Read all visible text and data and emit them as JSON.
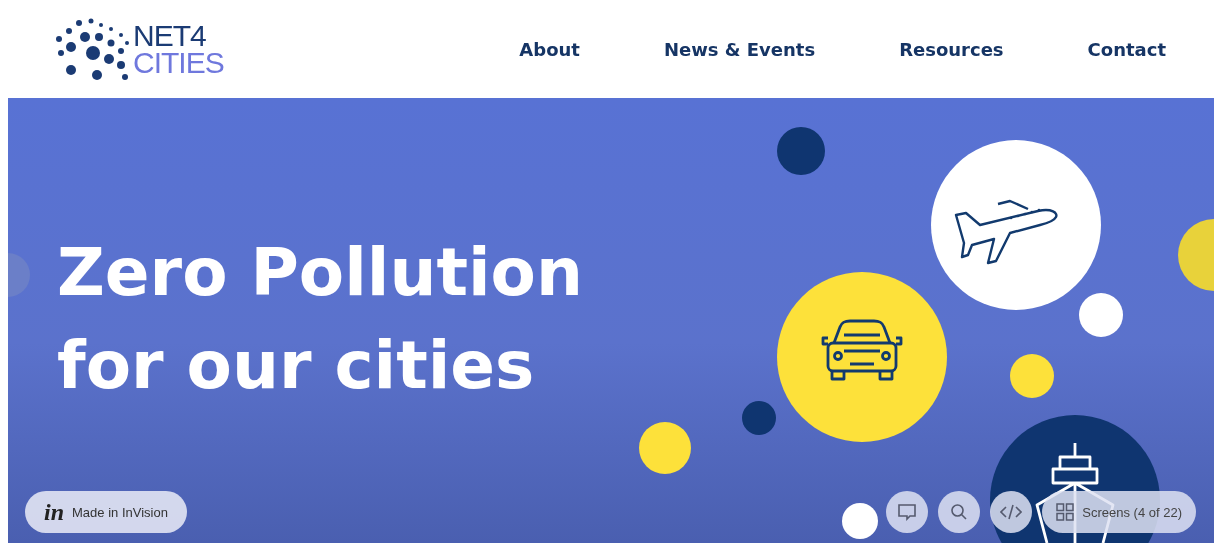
{
  "logo": {
    "line_1": "NET4",
    "line_2": "CITIES"
  },
  "nav": [
    {
      "label": "About"
    },
    {
      "label": "News & Events"
    },
    {
      "label": "Resources"
    },
    {
      "label": "Contact"
    }
  ],
  "hero": {
    "title_lines": [
      "Zero Pollution",
      "for our cities"
    ]
  },
  "prototype_bar": {
    "badge_mark": "in",
    "badge_label": "Made in InVision",
    "tools": [
      {
        "kind": "comment"
      },
      {
        "kind": "search"
      },
      {
        "kind": "code"
      }
    ],
    "screens_label": "Screens (4 of 22)"
  }
}
